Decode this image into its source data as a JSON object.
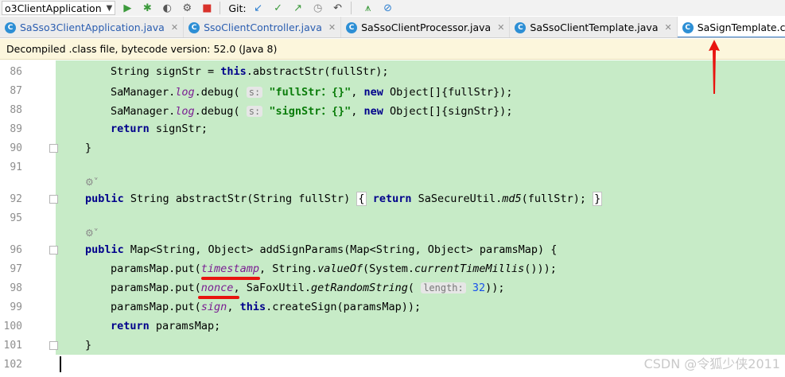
{
  "toolbar": {
    "run_config": "o3ClientApplication",
    "git_label": "Git:"
  },
  "tabs": [
    {
      "label": "SaSso3ClientApplication.java",
      "icon": "spring-class-icon",
      "active": false
    },
    {
      "label": "SsoClientController.java",
      "icon": "class-icon",
      "active": false
    },
    {
      "label": "SaSsoClientProcessor.java",
      "icon": "class-icon",
      "active": false
    },
    {
      "label": "SaSsoClientTemplate.java",
      "icon": "class-icon",
      "active": false
    },
    {
      "label": "SaSignTemplate.class",
      "icon": "class-icon",
      "active": true
    }
  ],
  "notice": "Decompiled .class file, bytecode version: 52.0 (Java 8)",
  "lines": [
    {
      "n": "86",
      "text": "String signStr = this.abstractStr(fullStr);"
    },
    {
      "n": "87",
      "text": "SaManager.log.debug( s: \"fullStr：{}\", new Object[]{fullStr});"
    },
    {
      "n": "88",
      "text": "SaManager.log.debug( s: \"signStr：{}\", new Object[]{signStr});"
    },
    {
      "n": "89",
      "text": "return signStr;"
    },
    {
      "n": "90",
      "text": "}"
    },
    {
      "n": "91",
      "text": ""
    },
    {
      "n": "92",
      "text": "public String abstractStr(String fullStr) { return SaSecureUtil.md5(fullStr); }"
    },
    {
      "n": "95",
      "text": ""
    },
    {
      "n": "96",
      "text": "public Map<String, Object> addSignParams(Map<String, Object> paramsMap) {"
    },
    {
      "n": "97",
      "text": "paramsMap.put(timestamp, String.valueOf(System.currentTimeMillis()));"
    },
    {
      "n": "98",
      "text": "paramsMap.put(nonce, SaFoxUtil.getRandomString( length: 32));"
    },
    {
      "n": "99",
      "text": "paramsMap.put(sign, this.createSign(paramsMap));"
    },
    {
      "n": "100",
      "text": "return paramsMap;"
    },
    {
      "n": "101",
      "text": "}"
    },
    {
      "n": "102",
      "text": ""
    }
  ],
  "tokens": {
    "string": "String",
    "signStr": "signStr",
    "this": "this",
    "abstractStr_call": ".abstractStr(fullStr);",
    "sam": "SaManager.",
    "log": "log",
    "debug": ".debug(",
    "hint_s": "s:",
    "str_full": "\"fullStr：{}\"",
    "str_sign": "\"signStr：{}\"",
    "new": "new",
    "obj_full": "Object[]{fullStr});",
    "obj_sign": "Object[]{signStr});",
    "return": "return",
    "signStr_semi": "signStr;",
    "close": "}",
    "public": "public",
    "abstract_sig": "String abstractStr(String fullStr)",
    "ob": "{",
    "secure": "SaSecureUtil.",
    "md5": "md5",
    "md5_arg": "(fullStr);",
    "map_sig": "Map<String, Object> addSignParams(Map<String, Object> paramsMap) {",
    "put": "paramsMap.put(",
    "timestamp": "timestamp",
    "str_value": ", String.",
    "valueOf": "valueOf",
    "sys": "(System.",
    "ctm": "currentTimeMillis",
    "ctm_end": "()));",
    "nonce": "nonce",
    "fox": ", SaFoxUtil.",
    "grs": "getRandomString",
    "grs_open": "(",
    "hint_len": "length:",
    "len_val": "32",
    "grs_end": "));",
    "sign": "sign",
    "comma": ", ",
    "create": ".createSign(paramsMap));",
    "paramsMap_semi": "paramsMap;"
  },
  "watermark": "CSDN @令狐少侠2011",
  "colors": {
    "code_bg": "#c7ebc7",
    "keyword": "#00008b",
    "field": "#7a1d92",
    "string": "#0a7c0a",
    "annotation_red": "#e8140f",
    "active_tab": "#4083c9"
  }
}
